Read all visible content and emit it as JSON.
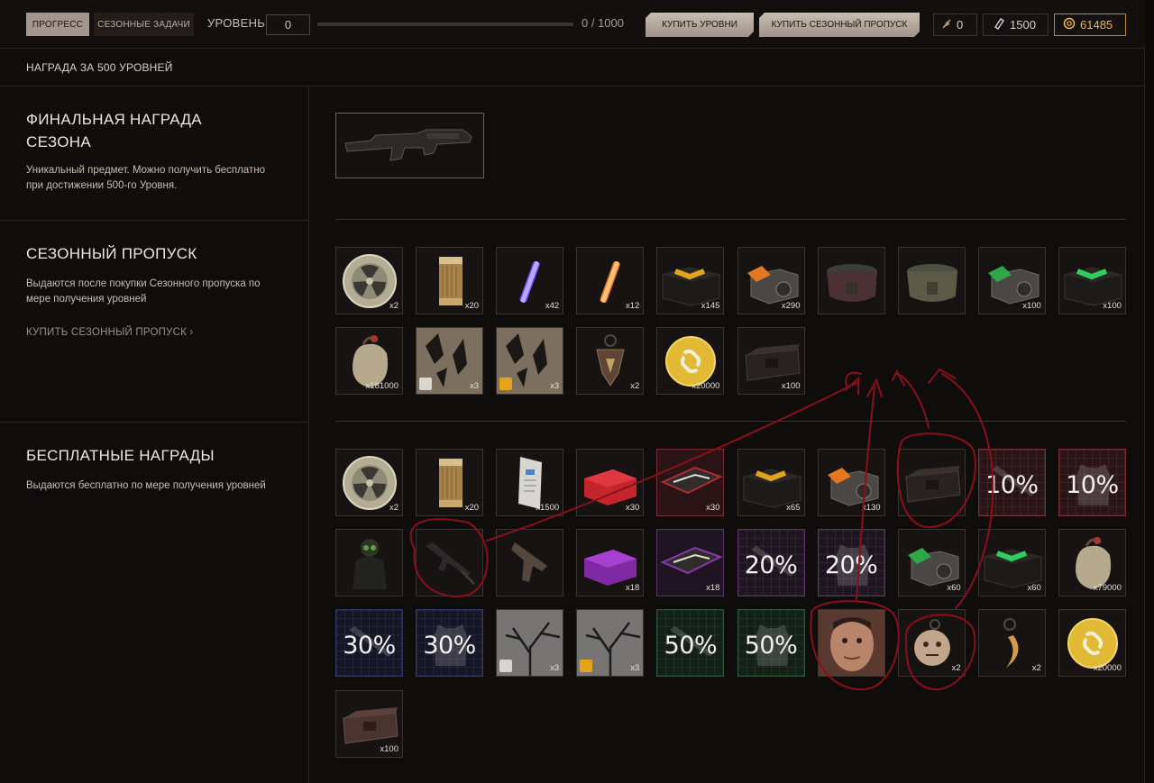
{
  "topbar": {
    "tab_progress": "ПРОГРЕСС",
    "tab_tasks": "СЕЗОННЫЕ ЗАДАЧИ",
    "level_label": "УРОВЕНЬ",
    "level_value": "0",
    "progress_text": "0 / 1000",
    "progress_fraction": 0.0,
    "buy_levels": "КУПИТЬ УРОВНИ",
    "buy_pass": "КУПИТЬ СЕЗОННЫЙ ПРОПУСК",
    "currency_1": "0",
    "currency_2": "1500",
    "currency_3": "61485",
    "currency_3_color": "#f0b840"
  },
  "subheader": {
    "text": "НАГРАДА ЗА 500 УРОВНЕЙ"
  },
  "final": {
    "title": "ФИНАЛЬНАЯ НАГРАДА СЕЗОНА",
    "desc": "Уникальный предмет. Можно получить бесплатно при достижении 500-го Уровня."
  },
  "pass": {
    "title": "СЕЗОННЫЙ ПРОПУСК",
    "desc": "Выдаются после покупки Сезонного пропуска по мере получения уровней",
    "link": "КУПИТЬ СЕЗОННЫЙ ПРОПУСК",
    "items": [
      {
        "icon": "radiation-token",
        "qty": "x2"
      },
      {
        "icon": "canister",
        "qty": "x20"
      },
      {
        "icon": "purple-glowstick",
        "qty": "x42"
      },
      {
        "icon": "orange-glowstick",
        "qty": "x12"
      },
      {
        "icon": "yellow-crate",
        "qty": "x145"
      },
      {
        "icon": "orange-crate",
        "qty": "x290"
      },
      {
        "icon": "pouch",
        "qty": ""
      },
      {
        "icon": "pouch-olive",
        "qty": ""
      },
      {
        "icon": "green-crate",
        "qty": "x100"
      },
      {
        "icon": "green-crate-dark",
        "qty": "x100"
      },
      {
        "icon": "sack",
        "qty": "x181000"
      },
      {
        "icon": "camo-armor",
        "qty": "x3"
      },
      {
        "icon": "camo-weapon",
        "qty": "x3"
      },
      {
        "icon": "keychain",
        "qty": "x2"
      },
      {
        "icon": "gold-coin",
        "qty": "x20000"
      },
      {
        "icon": "dark-chest",
        "qty": "x100"
      }
    ]
  },
  "free": {
    "title": "БЕСПЛАТНЫЕ НАГРАДЫ",
    "desc": "Выдаются бесплатно по мере получения уровней",
    "items": [
      {
        "icon": "radiation-token",
        "qty": "x2"
      },
      {
        "icon": "canister",
        "qty": "x20"
      },
      {
        "icon": "document",
        "qty": "x1500"
      },
      {
        "icon": "red-case",
        "qty": "x30"
      },
      {
        "icon": "weapon-case-red",
        "qty": "x30"
      },
      {
        "icon": "yellow-crate",
        "qty": "x65"
      },
      {
        "icon": "orange-crate",
        "qty": "x130"
      },
      {
        "icon": "dark-chest",
        "qty": ""
      },
      {
        "icon": "percent-weapon-red",
        "pct": "10%"
      },
      {
        "icon": "percent-armor-red",
        "pct": "10%"
      },
      {
        "icon": "character",
        "qty": ""
      },
      {
        "icon": "rifle",
        "qty": ""
      },
      {
        "icon": "pistol",
        "qty": ""
      },
      {
        "icon": "purple-case",
        "qty": "x18"
      },
      {
        "icon": "weapon-case-purple",
        "qty": "x18"
      },
      {
        "icon": "percent-weapon-purple",
        "pct": "20%"
      },
      {
        "icon": "percent-armor-purple",
        "pct": "20%"
      },
      {
        "icon": "green-crate",
        "qty": "x60"
      },
      {
        "icon": "green-crate-dark",
        "qty": "x60"
      },
      {
        "icon": "sack",
        "qty": "x79000"
      },
      {
        "icon": "percent-weapon-blue",
        "pct": "30%"
      },
      {
        "icon": "percent-armor-blue",
        "pct": "30%"
      },
      {
        "icon": "tree-armor",
        "qty": "x3"
      },
      {
        "icon": "tree-weapon",
        "qty": "x3"
      },
      {
        "icon": "percent-weapon-green",
        "pct": "50%"
      },
      {
        "icon": "percent-armor-green",
        "pct": "50%"
      },
      {
        "icon": "face",
        "qty": ""
      },
      {
        "icon": "mask-keychain",
        "qty": "x2"
      },
      {
        "icon": "knife-keychain",
        "qty": "x2"
      },
      {
        "icon": "gold-coin",
        "qty": "x20000"
      },
      {
        "icon": "dark-chest-brown",
        "qty": "x100"
      }
    ]
  }
}
